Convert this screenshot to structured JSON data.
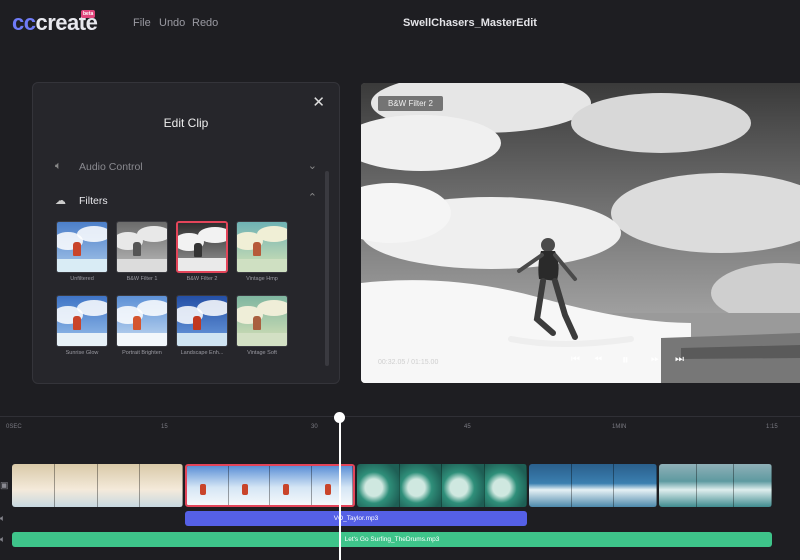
{
  "app": {
    "logo_cc": "cc",
    "logo_create": "create",
    "logo_badge": "beta",
    "menu": {
      "file": "File",
      "undo": "Undo",
      "redo": "Redo"
    },
    "project_title": "SwellChasers_MasterEdit"
  },
  "edit_panel": {
    "title": "Edit Clip",
    "sections": {
      "audio": "Audio Control",
      "filters": "Filters"
    },
    "filters": [
      {
        "name": "Unfiltered"
      },
      {
        "name": "B&W Filter 1"
      },
      {
        "name": "B&W Filter 2"
      },
      {
        "name": "Vintage Hmp"
      },
      {
        "name": "Sunrise Glow"
      },
      {
        "name": "Portrait Brighten"
      },
      {
        "name": "Landscape Enh..."
      },
      {
        "name": "Vintage Soft"
      }
    ],
    "selected_filter": "B&W Filter 2"
  },
  "preview": {
    "badge": "B&W Filter 2",
    "timecode": "00:32.05 / 01:15.00"
  },
  "timeline": {
    "ticks": [
      "0SEC",
      "15",
      "30",
      "45",
      "1MIN",
      "1:15"
    ],
    "audio_tracks": [
      "VO_Taylor.mp3",
      "Let's Go Surfing_TheDrums.mp3"
    ]
  },
  "colors": {
    "accent": "#6f7bf7",
    "selection": "#e3455a",
    "vo_track": "#5560e6",
    "music_track": "#3ec48a"
  }
}
